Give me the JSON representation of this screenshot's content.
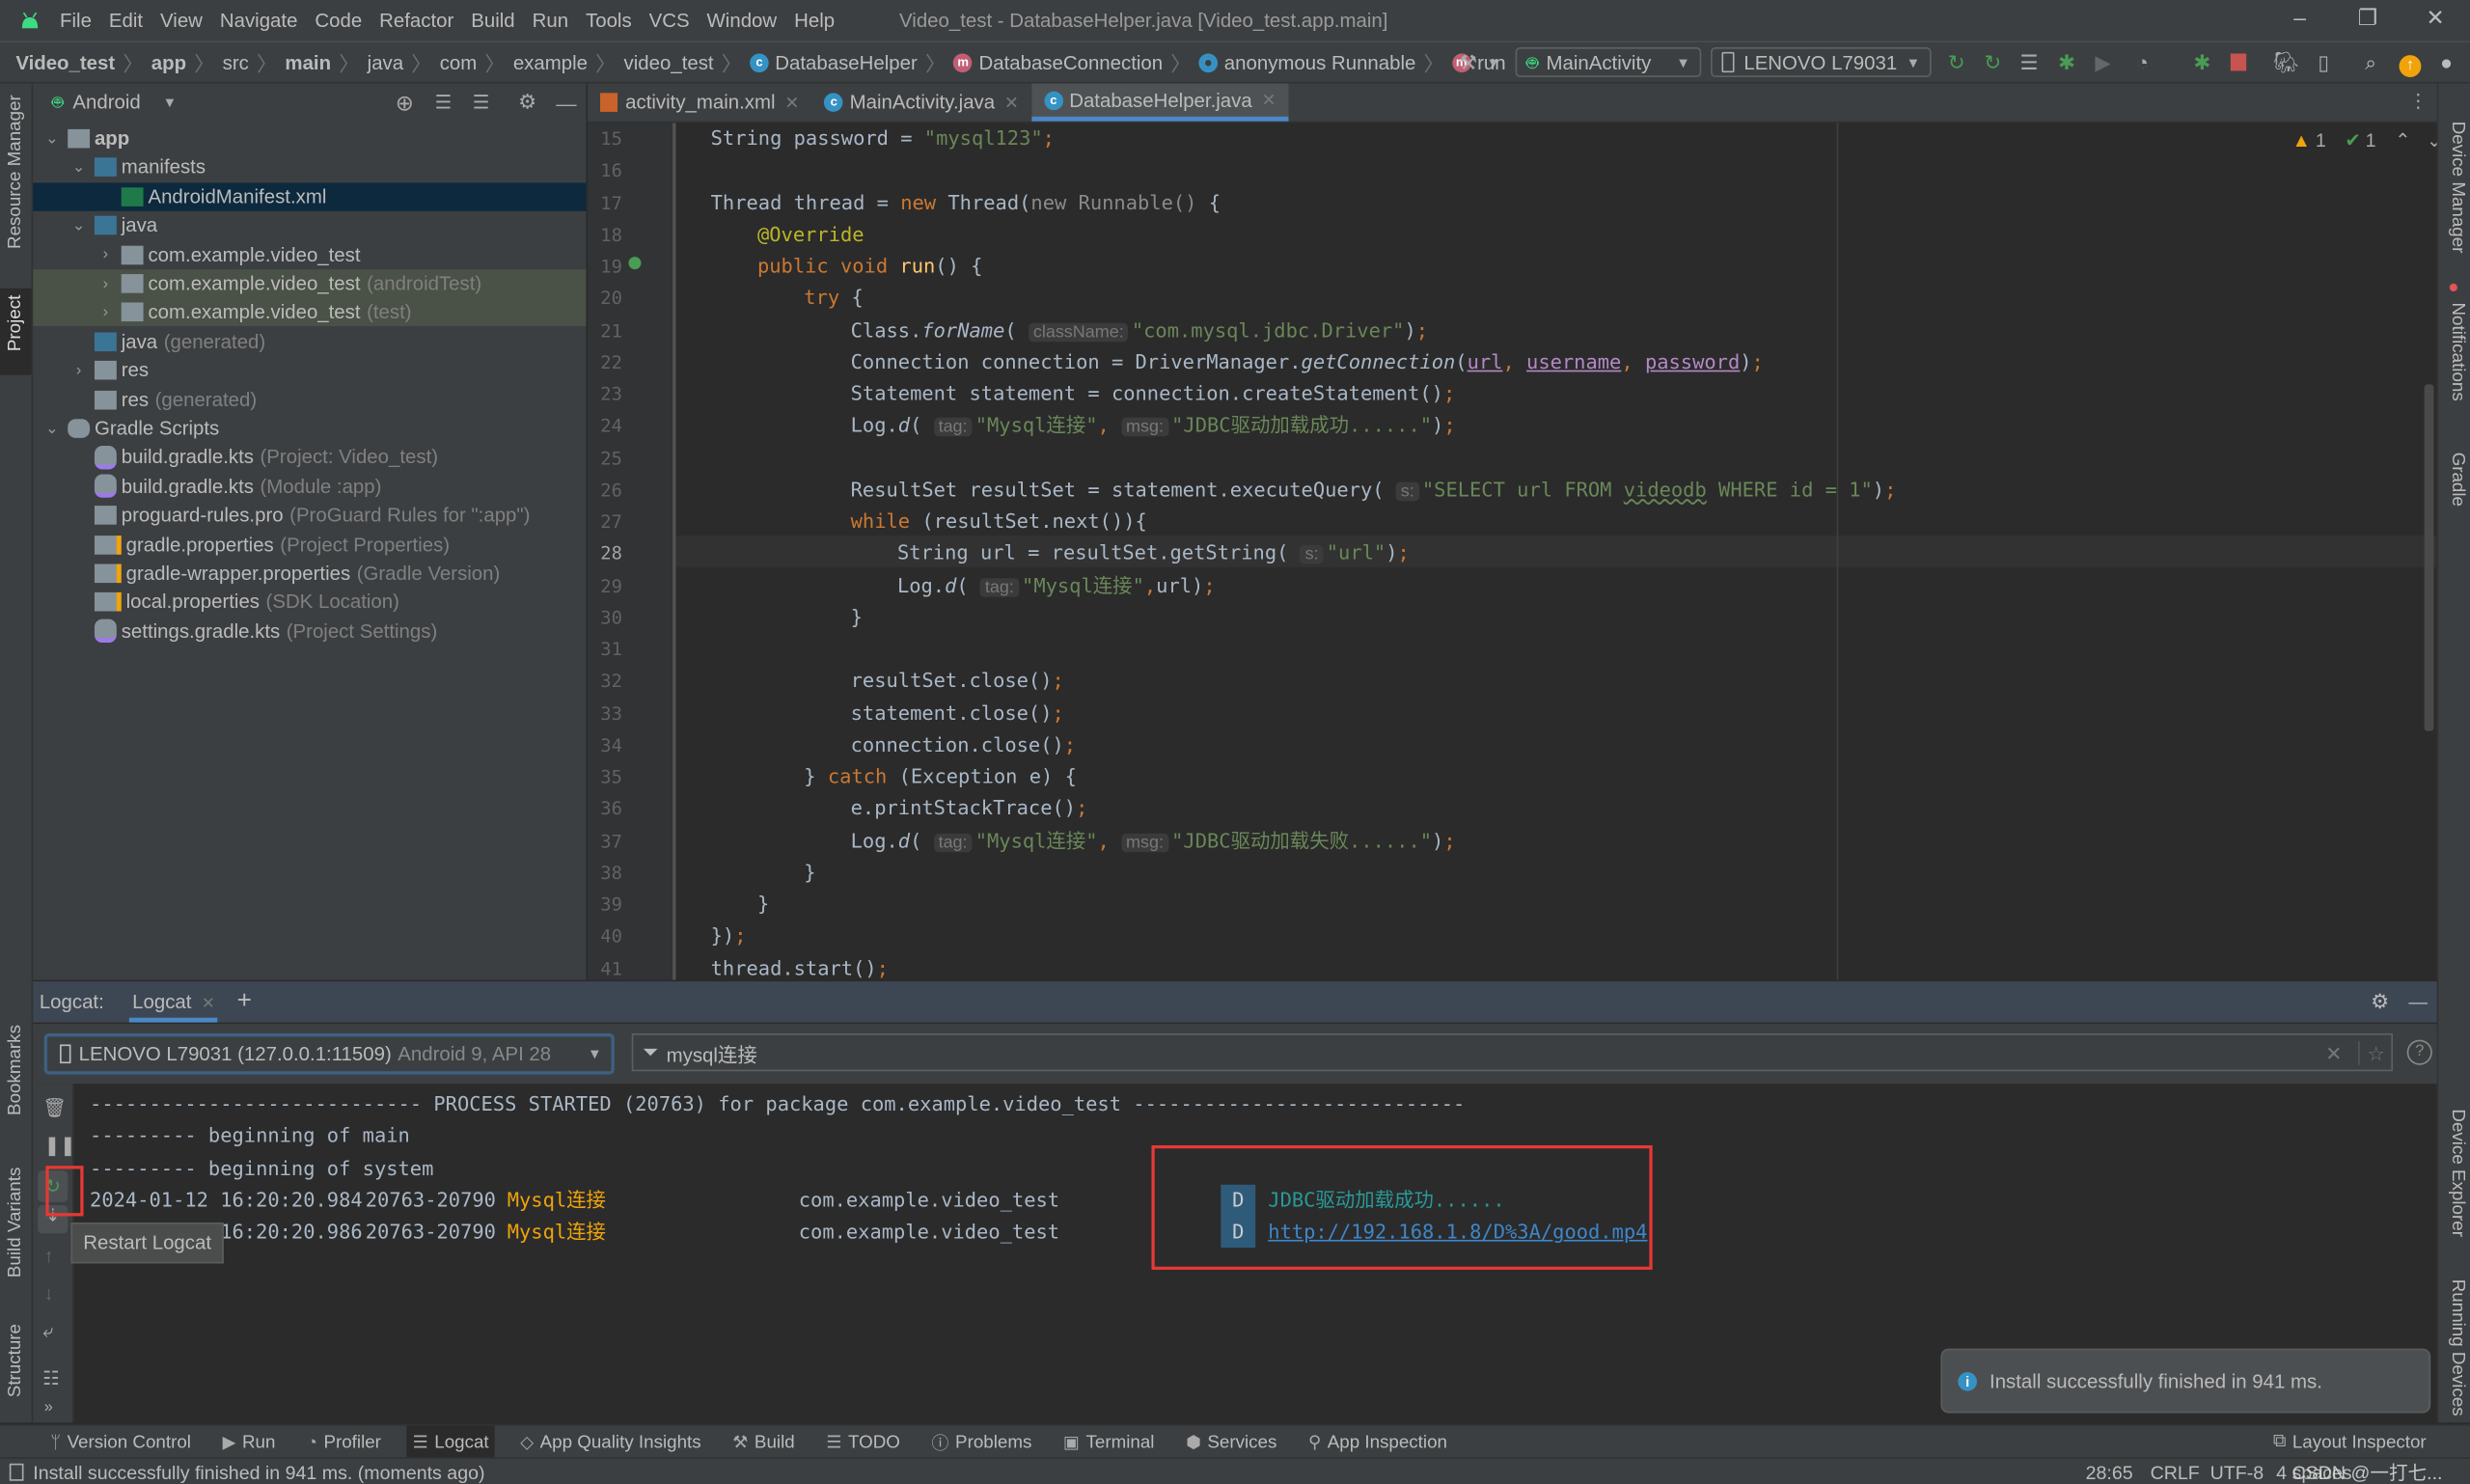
{
  "window": {
    "title": "Video_test - DatabaseHelper.java [Video_test.app.main]",
    "menu": [
      "File",
      "Edit",
      "View",
      "Navigate",
      "Code",
      "Refactor",
      "Build",
      "Run",
      "Tools",
      "VCS",
      "Window",
      "Help"
    ],
    "controls": {
      "minimize": "–",
      "restore": "❐",
      "close": "✕"
    }
  },
  "breadcrumb": [
    {
      "label": "Video_test",
      "bold": true
    },
    {
      "label": "app",
      "bold": true
    },
    {
      "label": "src"
    },
    {
      "label": "main",
      "bold": true
    },
    {
      "label": "java"
    },
    {
      "label": "com"
    },
    {
      "label": "example"
    },
    {
      "label": "video_test"
    },
    {
      "label": "DatabaseHelper",
      "icon": "class-icon"
    },
    {
      "label": "DatabaseConnection",
      "icon": "method-icon"
    },
    {
      "label": "anonymous Runnable",
      "icon": "anonymous-class-icon"
    },
    {
      "label": "run",
      "icon": "method-icon"
    }
  ],
  "toolbar": {
    "run_config": "MainActivity",
    "device": "LENOVO L79031"
  },
  "project_panel": {
    "view": "Android",
    "tree": [
      {
        "label": "app",
        "level": 0,
        "expanded": true,
        "bold": true,
        "icon": "module-folder-icon"
      },
      {
        "label": "manifests",
        "level": 1,
        "expanded": true,
        "icon": "folder-icon"
      },
      {
        "label": "AndroidManifest.xml",
        "level": 2,
        "icon": "manifest-file-icon",
        "selected": true
      },
      {
        "label": "java",
        "level": 1,
        "expanded": true,
        "icon": "folder-icon"
      },
      {
        "label": "com.example.video_test",
        "level": 2,
        "collapsed": true,
        "icon": "package-icon"
      },
      {
        "label": "com.example.video_test",
        "hint": "(androidTest)",
        "level": 2,
        "collapsed": true,
        "icon": "package-icon",
        "highlighted": true
      },
      {
        "label": "com.example.video_test",
        "hint": "(test)",
        "level": 2,
        "collapsed": true,
        "icon": "package-icon",
        "highlighted": true
      },
      {
        "label": "java",
        "hint": "(generated)",
        "level": 1,
        "icon": "generated-folder-icon"
      },
      {
        "label": "res",
        "level": 1,
        "collapsed": true,
        "icon": "res-folder-icon"
      },
      {
        "label": "res",
        "hint": "(generated)",
        "level": 1,
        "icon": "res-folder-icon"
      },
      {
        "label": "Gradle Scripts",
        "level": 0,
        "expanded": true,
        "icon": "gradle-icon"
      },
      {
        "label": "build.gradle.kts",
        "hint": "(Project: Video_test)",
        "level": 1,
        "icon": "gradle-kts-icon"
      },
      {
        "label": "build.gradle.kts",
        "hint": "(Module :app)",
        "level": 1,
        "icon": "gradle-kts-icon"
      },
      {
        "label": "proguard-rules.pro",
        "hint": "(ProGuard Rules for \":app\")",
        "level": 1,
        "icon": "text-file-icon"
      },
      {
        "label": "gradle.properties",
        "hint": "(Project Properties)",
        "level": 1,
        "icon": "properties-icon"
      },
      {
        "label": "gradle-wrapper.properties",
        "hint": "(Gradle Version)",
        "level": 1,
        "icon": "properties-icon"
      },
      {
        "label": "local.properties",
        "hint": "(SDK Location)",
        "level": 1,
        "icon": "properties-icon"
      },
      {
        "label": "settings.gradle.kts",
        "hint": "(Project Settings)",
        "level": 1,
        "icon": "gradle-kts-icon"
      }
    ]
  },
  "left_strip": [
    "Resource Manager",
    "Project",
    "Bookmarks",
    "Build Variants",
    "Structure"
  ],
  "right_strip": [
    "Device Manager",
    "Notifications",
    "Gradle",
    "Device Explorer",
    "Running Devices"
  ],
  "editor": {
    "tabs": [
      {
        "label": "activity_main.xml",
        "icon": "xml-file-icon"
      },
      {
        "label": "MainActivity.java",
        "icon": "class-icon"
      },
      {
        "label": "DatabaseHelper.java",
        "icon": "class-icon",
        "active": true
      }
    ],
    "inspections": {
      "warnings": "1",
      "weak_warnings": "1"
    },
    "current_line": 28,
    "lines": [
      {
        "n": 15,
        "indent": 2,
        "html": "String password = <span class=\"str\">\"mysql123\"</span><span class=\"kw\">;</span>"
      },
      {
        "n": 16,
        "indent": 0,
        "html": ""
      },
      {
        "n": 17,
        "indent": 2,
        "html": "Thread thread = <span class=\"kw\">new </span>Thread(<span class=\"dim\">new Runnable() </span>{"
      },
      {
        "n": 18,
        "indent": 3,
        "html": "<span class=\"ann\">@Override</span>"
      },
      {
        "n": 19,
        "indent": 3,
        "html": "<span class=\"kw\">public void </span><span class=\"fn\">run</span>() {"
      },
      {
        "n": 20,
        "indent": 4,
        "html": "<span class=\"kw\">try </span>{"
      },
      {
        "n": 21,
        "indent": 5,
        "html": "Class.<span class=\"it\">forName</span>( <span class=\"hint-box\">className:</span><span class=\"str\">\"com.mysql.jdbc.Driver\"</span>)<span class=\"kw\">;</span>"
      },
      {
        "n": 22,
        "indent": 5,
        "html": "Connection connection = DriverManager.<span class=\"it\">getConnection</span>(<span class=\"param\">url</span><span class=\"kw\">, </span><span class=\"param\">username</span><span class=\"kw\">, </span><span class=\"param\">password</span>)<span class=\"kw\">;</span>"
      },
      {
        "n": 23,
        "indent": 5,
        "html": "Statement statement = connection.createStatement()<span class=\"kw\">;</span>"
      },
      {
        "n": 24,
        "indent": 5,
        "html": "Log.<span class=\"it\">d</span>( <span class=\"hint-box\">tag:</span><span class=\"str\">\"Mysql连接\"</span><span class=\"kw\">, </span><span class=\"hint-box\">msg:</span><span class=\"str\">\"JDBC驱动加载成功......\"</span>)<span class=\"kw\">;</span>"
      },
      {
        "n": 25,
        "indent": 0,
        "html": ""
      },
      {
        "n": 26,
        "indent": 5,
        "html": "ResultSet resultSet = statement.executeQuery( <span class=\"hint-box\">s:</span><span class=\"str\">\"SELECT url FROM <span class=\"squig\">videodb</span> WHERE id = 1\"</span>)<span class=\"kw\">;</span>"
      },
      {
        "n": 27,
        "indent": 5,
        "html": "<span class=\"kw\">while </span>(resultSet.next()){"
      },
      {
        "n": 28,
        "indent": 6,
        "html": "String url = resultSet.getString( <span class=\"hint-box\">s:</span><span class=\"str\">\"url\"</span>)<span class=\"kw\">;</span>"
      },
      {
        "n": 29,
        "indent": 6,
        "html": "Log.<span class=\"it\">d</span>( <span class=\"hint-box\">tag:</span><span class=\"str\">\"Mysql连接\"</span><span class=\"kw\">,</span>url)<span class=\"kw\">;</span>"
      },
      {
        "n": 30,
        "indent": 5,
        "html": "}"
      },
      {
        "n": 31,
        "indent": 0,
        "html": ""
      },
      {
        "n": 32,
        "indent": 5,
        "html": "resultSet.close()<span class=\"kw\">;</span>"
      },
      {
        "n": 33,
        "indent": 5,
        "html": "statement.close()<span class=\"kw\">;</span>"
      },
      {
        "n": 34,
        "indent": 5,
        "html": "connection.close()<span class=\"kw\">;</span>"
      },
      {
        "n": 35,
        "indent": 4,
        "html": "} <span class=\"kw\">catch </span>(Exception e) {"
      },
      {
        "n": 36,
        "indent": 5,
        "html": "e.printStackTrace()<span class=\"kw\">;</span>"
      },
      {
        "n": 37,
        "indent": 5,
        "html": "Log.<span class=\"it\">d</span>( <span class=\"hint-box\">tag:</span><span class=\"str\">\"Mysql连接\"</span><span class=\"kw\">, </span><span class=\"hint-box\">msg:</span><span class=\"str\">\"JDBC驱动加载失败......\"</span>)<span class=\"kw\">;</span>"
      },
      {
        "n": 38,
        "indent": 4,
        "html": "}"
      },
      {
        "n": 39,
        "indent": 3,
        "html": "}"
      },
      {
        "n": 40,
        "indent": 2,
        "html": "})<span class=\"kw\">;</span>"
      },
      {
        "n": 41,
        "indent": 2,
        "html": "thread.start()<span class=\"kw\">;</span>"
      }
    ]
  },
  "logcat": {
    "label": "Logcat:",
    "tab": "Logcat",
    "device": "LENOVO L79031 (127.0.0.1:11509)",
    "device_detail": "Android 9, API 28",
    "filter": "mysql连接",
    "tooltip": "Restart Logcat",
    "lines": [
      {
        "text": "---------------------------- PROCESS STARTED (20763) for package com.example.video_test ----------------------------"
      },
      {
        "text": "--------- beginning of main"
      },
      {
        "text": "--------- beginning of system"
      },
      {
        "timestamp": "2024-01-12 16:20:20.984",
        "pid": "20763-20790",
        "tag": "Mysql连接",
        "package": "com.example.video_test",
        "level": "D",
        "message": "JDBC驱动加载成功......"
      },
      {
        "timestamp": "2024-01-12 16:20:20.986",
        "pid": "20763-20790",
        "tag": "Mysql连接",
        "package": "com.example.video_test",
        "level": "D",
        "message": "http://192.168.1.8/D%3A/good.mp4",
        "is_link": true
      }
    ]
  },
  "notification": "Install successfully finished in 941 ms.",
  "tool_windows": [
    {
      "label": "Version Control",
      "icon": "vcs-icon"
    },
    {
      "label": "Run",
      "icon": "run-icon"
    },
    {
      "label": "Profiler",
      "icon": "profiler-icon"
    },
    {
      "label": "Logcat",
      "icon": "logcat-icon",
      "active": true
    },
    {
      "label": "App Quality Insights",
      "icon": "diamond-icon"
    },
    {
      "label": "Build",
      "icon": "hammer-icon"
    },
    {
      "label": "TODO",
      "icon": "list-icon"
    },
    {
      "label": "Problems",
      "icon": "problems-icon"
    },
    {
      "label": "Terminal",
      "icon": "terminal-icon"
    },
    {
      "label": "Services",
      "icon": "services-icon"
    },
    {
      "label": "App Inspection",
      "icon": "inspection-icon"
    }
  ],
  "layout_inspector": "Layout Inspector",
  "status": {
    "message": "Install successfully finished in 941 ms. (moments ago)",
    "position": "28:65",
    "line_sep": "CRLF",
    "encoding": "UTF-8",
    "indent": "4 spaces",
    "watermark": "CSDN @一打七..."
  },
  "colors": {
    "accent": "#4a88c7",
    "highlight_red": "#e53935",
    "tag_orange": "#f0a30a",
    "link_blue": "#3f86c9"
  }
}
